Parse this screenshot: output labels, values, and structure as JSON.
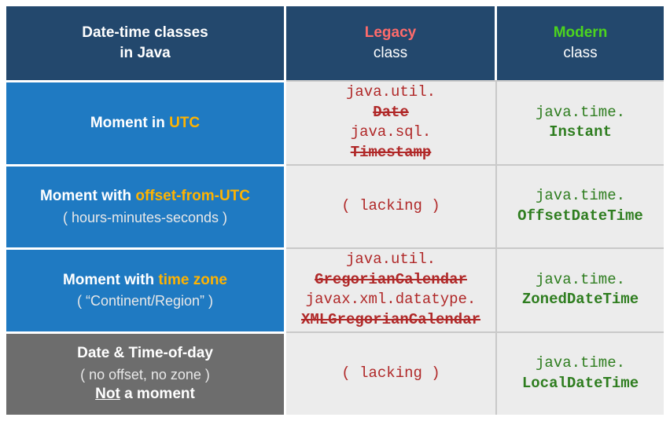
{
  "header": {
    "desc_title": "Date-time classes",
    "desc_sub": "in Java",
    "legacy_word": "Legacy",
    "legacy_sub": "class",
    "modern_word": "Modern",
    "modern_sub": "class"
  },
  "rows": {
    "r1": {
      "desc_main_pre": "Moment in ",
      "desc_main_hl": "UTC",
      "legacy_pkg1": "java.util.",
      "legacy_cls1": "Date",
      "legacy_pkg2": "java.sql.",
      "legacy_cls2": "Timestamp",
      "modern_pkg": "java.time.",
      "modern_cls": "Instant"
    },
    "r2": {
      "desc_main_pre": "Moment with ",
      "desc_main_hl": "offset-from-UTC",
      "desc_sub": "( hours-minutes-seconds )",
      "legacy_lacking": "( lacking )",
      "modern_pkg": "java.time.",
      "modern_cls": "OffsetDateTime"
    },
    "r3": {
      "desc_main_pre": "Moment with ",
      "desc_main_hl": "time zone",
      "desc_sub": "( “Continent/Region” )",
      "legacy_pkg1": "java.util.",
      "legacy_cls1": "GregorianCalendar",
      "legacy_pkg2": "javax.xml.datatype.",
      "legacy_cls2": "XMLGregorianCalendar",
      "modern_pkg": "java.time.",
      "modern_cls": "ZonedDateTime"
    },
    "r4": {
      "desc_main": "Date & Time-of-day",
      "desc_sub1": "( no offset, no zone )",
      "desc_sub2_hl": "Not",
      "desc_sub2_rest": " a moment",
      "legacy_lacking": "( lacking )",
      "modern_pkg": "java.time.",
      "modern_cls": "LocalDateTime"
    }
  }
}
